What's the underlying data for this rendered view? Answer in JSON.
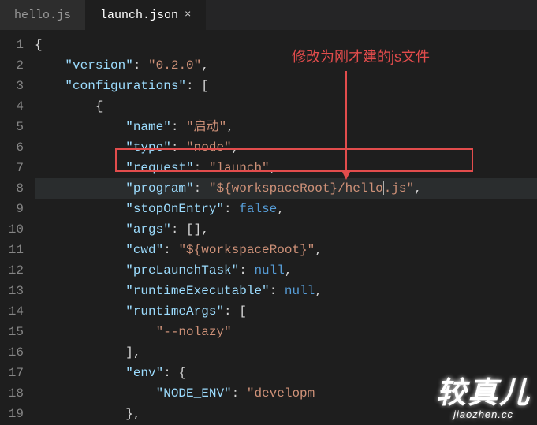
{
  "tabs": {
    "inactive": "hello.js",
    "active": "launch.json",
    "close_glyph": "×"
  },
  "gutter": [
    "1",
    "2",
    "3",
    "4",
    "5",
    "6",
    "7",
    "8",
    "9",
    "10",
    "11",
    "12",
    "13",
    "14",
    "15",
    "16",
    "17",
    "18",
    "19"
  ],
  "annotation": {
    "text": "修改为刚才建的js文件"
  },
  "watermark": {
    "big": "较真儿",
    "small": "jiaozhen.cc"
  },
  "code": {
    "l1": "{",
    "l2_key": "\"version\"",
    "l2_val": "\"0.2.0\"",
    "l3_key": "\"configurations\"",
    "l4": "{",
    "l5_key": "\"name\"",
    "l5_val": "\"启动\"",
    "l6_key": "\"type\"",
    "l6_val": "\"node\"",
    "l7_key": "\"request\"",
    "l7_val": "\"launch\"",
    "l8_key": "\"program\"",
    "l8_val_a": "\"${workspaceRoot}/hello",
    "l8_val_b": ".js\"",
    "l9_key": "\"stopOnEntry\"",
    "l9_val": "false",
    "l10_key": "\"args\"",
    "l11_key": "\"cwd\"",
    "l11_val": "\"${workspaceRoot}\"",
    "l12_key": "\"preLaunchTask\"",
    "l12_val": "null",
    "l13_key": "\"runtimeExecutable\"",
    "l13_val": "null",
    "l14_key": "\"runtimeArgs\"",
    "l15_val": "\"--nolazy\"",
    "l16": "],",
    "l17_key": "\"env\"",
    "l18_key": "\"NODE_ENV\"",
    "l18_val": "\"developm"
  }
}
